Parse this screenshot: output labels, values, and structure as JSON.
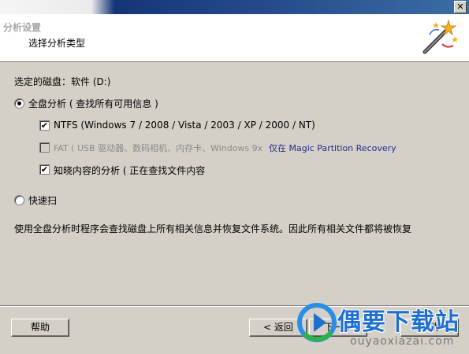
{
  "titlebar": {
    "close_glyph": "✕"
  },
  "header": {
    "title": "分析设置",
    "subtitle": "选择分析类型",
    "icon": "magic-wand-icon"
  },
  "content": {
    "selected_disk": "选定的磁盘：软件 (D:)",
    "full_analysis": {
      "label": "全盘分析 ( 查找所有可用信息 )",
      "checked": true
    },
    "ntfs": {
      "label": "NTFS (Windows 7 / 2008 / Vista / 2003 / XP / 2000 / NT)",
      "checked": true
    },
    "fat": {
      "label": "FAT ( USB 驱动器、数码相机、内存卡、Windows 9x",
      "link": "仅在 Magic Partition Recovery",
      "checked": false,
      "disabled": true
    },
    "content_aware": {
      "label": "知晓内容的分析 ( 正在查找文件内容",
      "checked": true
    },
    "quick_scan": {
      "label": "快速扫",
      "checked": false
    },
    "description": "使用全盘分析时程序会查找磁盘上所有相关信息并恢复文件系统。因此所有相关文件都将被恢复"
  },
  "buttons": {
    "help": "帮助",
    "back": "< 返回",
    "next": "下一步",
    "cancel": "取消"
  },
  "watermark": {
    "text": "偶要下载站",
    "url": "ouyaoxiazai.com"
  },
  "colors": {
    "link": "#1a2e8c",
    "titlebar": "#0a246a",
    "watermark": "#1e6fd0"
  }
}
